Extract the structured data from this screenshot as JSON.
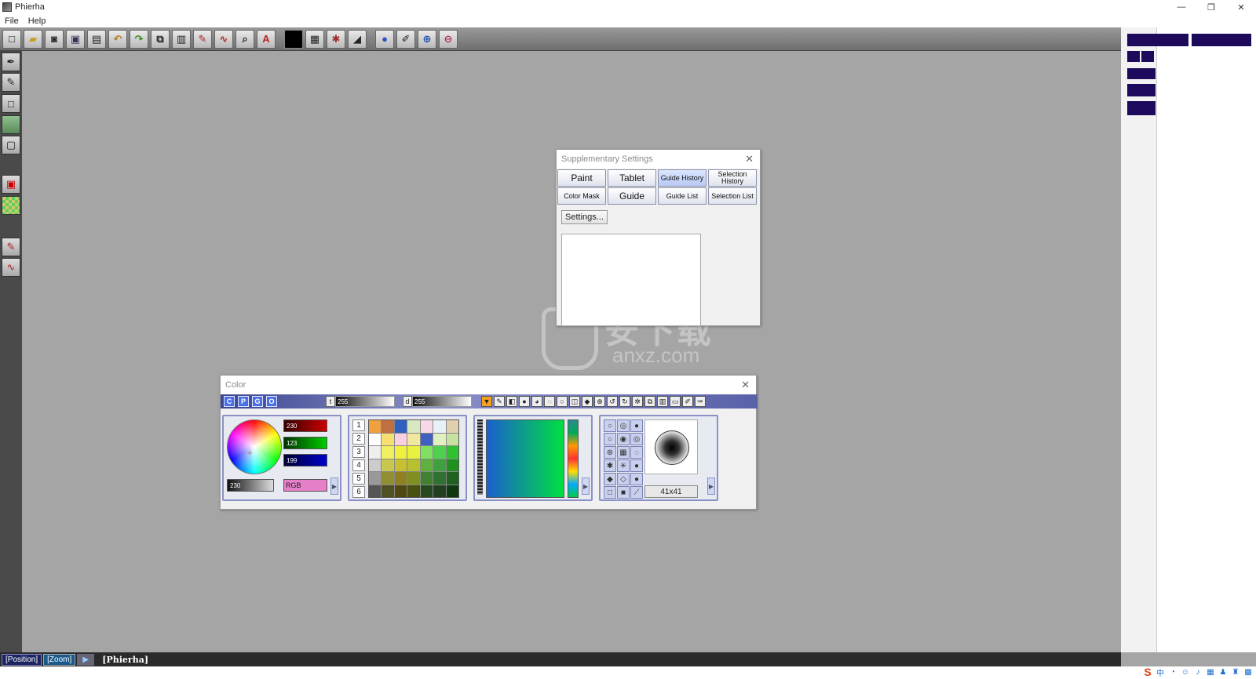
{
  "window": {
    "title": "Phierha",
    "minimize_glyph": "—",
    "restore_glyph": "❐",
    "close_glyph": "✕"
  },
  "menu": {
    "items": [
      "File",
      "Help"
    ]
  },
  "supp_settings": {
    "title": "Supplementary Settings",
    "tabs": [
      "Paint",
      "Tablet",
      "Guide History",
      "Selection History",
      "Color Mask",
      "Guide",
      "Guide List",
      "Selection List"
    ],
    "settings_button": "Settings..."
  },
  "color_window": {
    "title": "Color",
    "mode_buttons": [
      "C",
      "P",
      "G",
      "O"
    ],
    "t_label": "t",
    "t_value": "255",
    "d_label": "d",
    "d_value": "255",
    "r_value": "230",
    "g_value": "123",
    "b_value": "199",
    "gray_value": "230",
    "color_model": "RGB",
    "palette_numbers": [
      "1",
      "2",
      "3",
      "4",
      "5",
      "6"
    ],
    "brush_size": "41x41",
    "swatch_color": "#e67fc7"
  },
  "statusbar": {
    "position_label": "[Position]",
    "zoom_label": "[Zoom]",
    "document_name": "[Phierha]"
  },
  "watermark": {
    "text": "安下载",
    "subtext": "anxz.com"
  },
  "colors": {
    "right_panel_block": "#1e0a5c",
    "accent_blue": "#4a70e8"
  }
}
